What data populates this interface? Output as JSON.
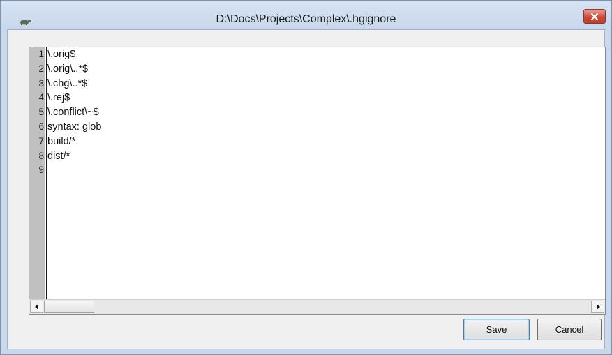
{
  "window": {
    "title": "D:\\Docs\\Projects\\Complex\\.hgignore",
    "app_icon": "tortoise-icon",
    "close_icon": "close-icon"
  },
  "editor": {
    "line_numbers": [
      "1",
      "2",
      "3",
      "4",
      "5",
      "6",
      "7",
      "8",
      "9"
    ],
    "lines": [
      "\\.orig$",
      "\\.orig\\..*$",
      "\\.chg\\..*$",
      "\\.rej$",
      "\\.conflict\\~$",
      "syntax: glob",
      "build/*",
      "dist/*",
      ""
    ]
  },
  "buttons": {
    "save_label": "Save",
    "cancel_label": "Cancel"
  }
}
